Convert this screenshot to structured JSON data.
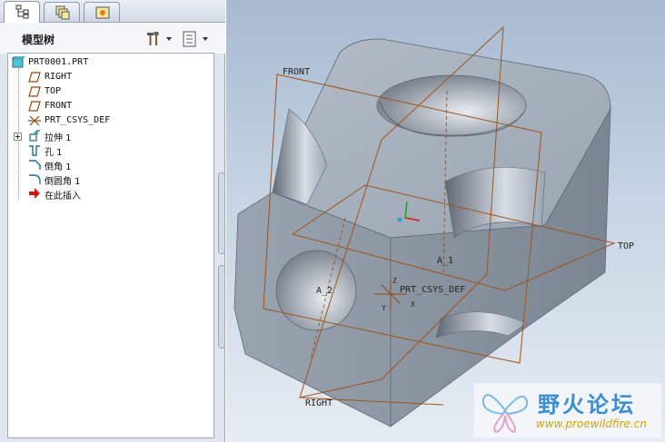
{
  "panel": {
    "tabs": [
      {
        "icon": "model-tree-tab-icon",
        "active": true
      },
      {
        "icon": "layers-tab-icon",
        "active": false
      },
      {
        "icon": "favorites-tab-icon",
        "active": false
      }
    ],
    "title": "模型树",
    "tools_icon": "tools-hammer-icon",
    "view_icon": "tree-settings-icon"
  },
  "tree": {
    "root": "PRT0001.PRT",
    "items": [
      {
        "label": "RIGHT",
        "icon": "datum-plane-icon"
      },
      {
        "label": "TOP",
        "icon": "datum-plane-icon"
      },
      {
        "label": "FRONT",
        "icon": "datum-plane-icon"
      },
      {
        "label": "PRT_CSYS_DEF",
        "icon": "coordinate-system-icon"
      },
      {
        "label": "拉伸 1",
        "icon": "extrude-icon"
      },
      {
        "label": "孔 1",
        "icon": "hole-icon"
      },
      {
        "label": "倒角 1",
        "icon": "chamfer-icon"
      },
      {
        "label": "倒圆角 1",
        "icon": "round-icon"
      },
      {
        "label": "在此插入",
        "icon": "insert-here-arrow-icon"
      }
    ]
  },
  "viewport": {
    "labels": {
      "front": "FRONT",
      "top": "TOP",
      "right": "RIGHT",
      "csys": "PRT_CSYS_DEF",
      "axis1": "A_1",
      "axis2": "A_2",
      "csys_x": "X",
      "csys_y": "Y",
      "csys_z": "Z"
    },
    "colors": {
      "datum": "#a0521e",
      "part": "#9aa5b3"
    }
  },
  "watermark": {
    "title": "野火论坛",
    "url": "www.proewildfire.cn"
  }
}
